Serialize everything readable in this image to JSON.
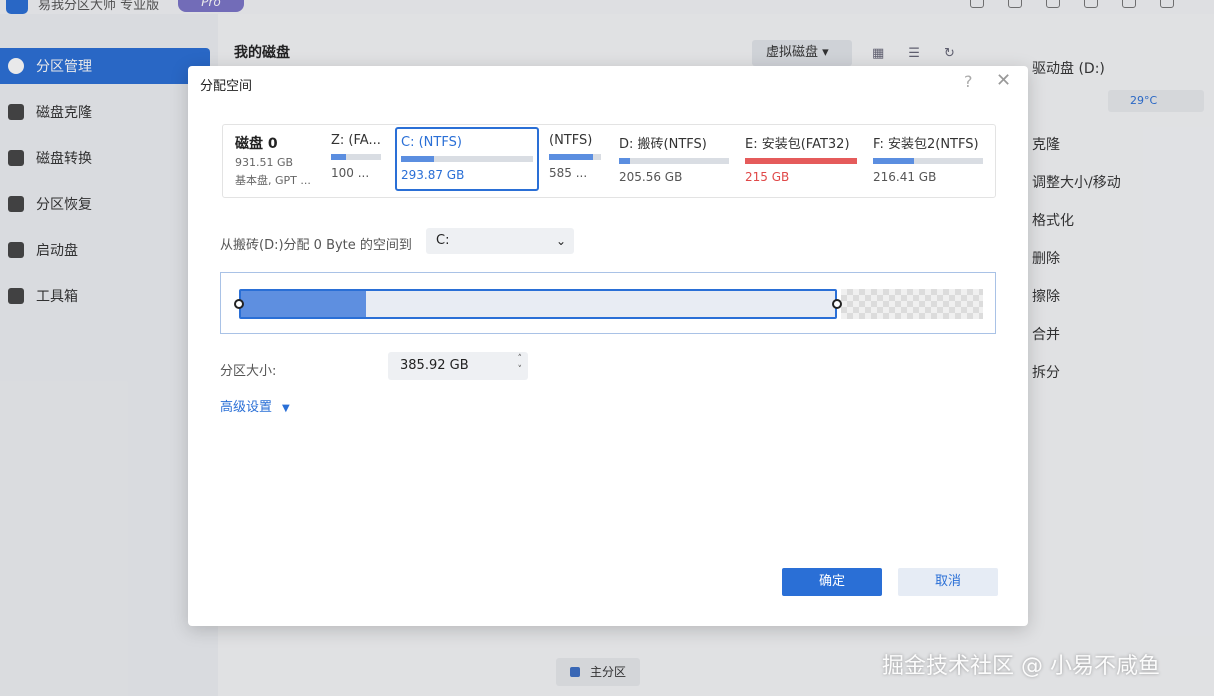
{
  "app": {
    "title": "易我分区大师 专业版",
    "badge": "Pro"
  },
  "sidebar": {
    "items": [
      {
        "label": "分区管理",
        "active": true
      },
      {
        "label": "磁盘克隆"
      },
      {
        "label": "磁盘转换"
      },
      {
        "label": "分区恢复"
      },
      {
        "label": "启动盘"
      },
      {
        "label": "工具箱"
      }
    ]
  },
  "main": {
    "heading": "我的磁盘",
    "virtual_disk_btn": "虚拟磁盘"
  },
  "right_panel": {
    "title": "驱动盘 (D:)",
    "temperature": "29°C",
    "actions": [
      "克隆",
      "调整大小/移动",
      "格式化",
      "删除",
      "擦除",
      "合并",
      "拆分"
    ]
  },
  "bottom_legend": "主分区",
  "dialog": {
    "title": "分配空间",
    "help": "?",
    "close": "✕",
    "disk": {
      "name": "磁盘 0",
      "size": "931.51 GB",
      "type": "基本盘, GPT ..."
    },
    "partitions": [
      {
        "name": "Z: (FA...",
        "size": "100 ...",
        "used_fraction": 0.3
      },
      {
        "name": "C: (NTFS)",
        "size": "293.87 GB",
        "used_fraction": 0.25,
        "selected": true
      },
      {
        "name": "(NTFS)",
        "size": "585 ...",
        "used_fraction": 0.85
      },
      {
        "name": "D: 搬砖(NTFS)",
        "size": "205.56 GB",
        "used_fraction": 0.1
      },
      {
        "name": "E: 安装包(FAT32)",
        "size": "215 GB",
        "used_fraction": 1.0,
        "error": true
      },
      {
        "name": "F: 安装包2(NTFS)",
        "size": "216.41 GB",
        "used_fraction": 0.37
      }
    ],
    "allocate_label": "从搬砖(D:)分配 0 Byte 的空间到",
    "allocate_target": "C:",
    "used_fraction": 0.21,
    "size_label": "分区大小:",
    "size_value": "385.92 GB",
    "advanced": "高级设置",
    "ok": "确定",
    "cancel": "取消"
  },
  "watermark": "掘金技术社区 @ 小易不咸鱼",
  "colors": {
    "accent": "#2a6fd6",
    "bar_fill": "#5b8ee0",
    "error": "#e55b5b"
  }
}
